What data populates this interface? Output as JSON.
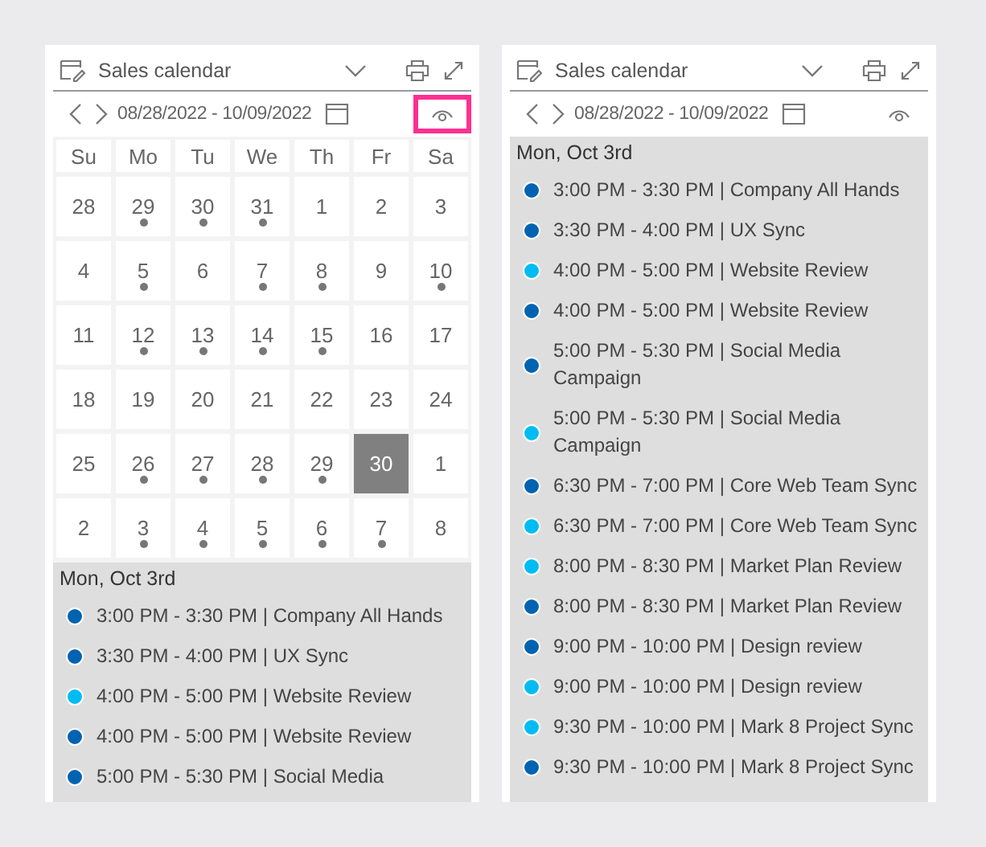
{
  "panels": [
    {
      "title": "Sales calendar",
      "date_range": "08/28/2022 - 10/09/2022",
      "view_toggle_highlighted": true,
      "weekdays": [
        "Su",
        "Mo",
        "Tu",
        "We",
        "Th",
        "Fr",
        "Sa"
      ],
      "weeks": [
        [
          {
            "day": "28",
            "dot": false,
            "selected": false
          },
          {
            "day": "29",
            "dot": true,
            "selected": false
          },
          {
            "day": "30",
            "dot": true,
            "selected": false
          },
          {
            "day": "31",
            "dot": true,
            "selected": false
          },
          {
            "day": "1",
            "dot": false,
            "selected": false
          },
          {
            "day": "2",
            "dot": false,
            "selected": false
          },
          {
            "day": "3",
            "dot": false,
            "selected": false
          }
        ],
        [
          {
            "day": "4",
            "dot": false,
            "selected": false
          },
          {
            "day": "5",
            "dot": true,
            "selected": false
          },
          {
            "day": "6",
            "dot": false,
            "selected": false
          },
          {
            "day": "7",
            "dot": true,
            "selected": false
          },
          {
            "day": "8",
            "dot": true,
            "selected": false
          },
          {
            "day": "9",
            "dot": false,
            "selected": false
          },
          {
            "day": "10",
            "dot": true,
            "selected": false
          }
        ],
        [
          {
            "day": "11",
            "dot": false,
            "selected": false
          },
          {
            "day": "12",
            "dot": true,
            "selected": false
          },
          {
            "day": "13",
            "dot": true,
            "selected": false
          },
          {
            "day": "14",
            "dot": true,
            "selected": false
          },
          {
            "day": "15",
            "dot": true,
            "selected": false
          },
          {
            "day": "16",
            "dot": false,
            "selected": false
          },
          {
            "day": "17",
            "dot": false,
            "selected": false
          }
        ],
        [
          {
            "day": "18",
            "dot": false,
            "selected": false
          },
          {
            "day": "19",
            "dot": false,
            "selected": false
          },
          {
            "day": "20",
            "dot": false,
            "selected": false
          },
          {
            "day": "21",
            "dot": false,
            "selected": false
          },
          {
            "day": "22",
            "dot": false,
            "selected": false
          },
          {
            "day": "23",
            "dot": false,
            "selected": false
          },
          {
            "day": "24",
            "dot": false,
            "selected": false
          }
        ],
        [
          {
            "day": "25",
            "dot": false,
            "selected": false
          },
          {
            "day": "26",
            "dot": true,
            "selected": false
          },
          {
            "day": "27",
            "dot": true,
            "selected": false
          },
          {
            "day": "28",
            "dot": true,
            "selected": false
          },
          {
            "day": "29",
            "dot": true,
            "selected": false
          },
          {
            "day": "30",
            "dot": false,
            "selected": true
          },
          {
            "day": "1",
            "dot": false,
            "selected": false
          }
        ],
        [
          {
            "day": "2",
            "dot": false,
            "selected": false
          },
          {
            "day": "3",
            "dot": true,
            "selected": false
          },
          {
            "day": "4",
            "dot": true,
            "selected": false
          },
          {
            "day": "5",
            "dot": true,
            "selected": false
          },
          {
            "day": "6",
            "dot": true,
            "selected": false
          },
          {
            "day": "7",
            "dot": true,
            "selected": false
          },
          {
            "day": "8",
            "dot": false,
            "selected": false
          }
        ]
      ],
      "agenda_heading": "Mon, Oct 3rd",
      "events": [
        {
          "text": "3:00 PM - 3:30 PM | Company All Hands",
          "color": "#0063b1"
        },
        {
          "text": "3:30 PM - 4:00 PM | UX Sync",
          "color": "#0063b1"
        },
        {
          "text": "4:00 PM - 5:00 PM | Website Review",
          "color": "#00bcf2"
        },
        {
          "text": "4:00 PM - 5:00 PM | Website Review",
          "color": "#0063b1"
        },
        {
          "text": "5:00 PM - 5:30 PM | Social Media",
          "color": "#0063b1"
        }
      ]
    },
    {
      "title": "Sales calendar",
      "date_range": "08/28/2022 - 10/09/2022",
      "view_toggle_highlighted": false,
      "agenda_heading": "Mon, Oct 3rd",
      "events": [
        {
          "text": "3:00 PM - 3:30 PM | Company All Hands",
          "color": "#0063b1"
        },
        {
          "text": "3:30 PM - 4:00 PM | UX Sync",
          "color": "#0063b1"
        },
        {
          "text": "4:00 PM - 5:00 PM | Website Review",
          "color": "#00bcf2"
        },
        {
          "text": "4:00 PM - 5:00 PM | Website Review",
          "color": "#0063b1"
        },
        {
          "text": "5:00 PM - 5:30 PM | Social Media Campaign",
          "color": "#0063b1"
        },
        {
          "text": "5:00 PM - 5:30 PM | Social Media Campaign",
          "color": "#00bcf2"
        },
        {
          "text": "6:30 PM - 7:00 PM | Core Web Team Sync",
          "color": "#0063b1"
        },
        {
          "text": "6:30 PM - 7:00 PM | Core Web Team Sync",
          "color": "#00bcf2"
        },
        {
          "text": "8:00 PM - 8:30 PM | Market Plan Review",
          "color": "#00bcf2"
        },
        {
          "text": "8:00 PM - 8:30 PM | Market Plan Review",
          "color": "#0063b1"
        },
        {
          "text": "9:00 PM - 10:00 PM | Design review",
          "color": "#0063b1"
        },
        {
          "text": "9:00 PM - 10:00 PM | Design review",
          "color": "#00bcf2"
        },
        {
          "text": "9:30 PM - 10:00 PM | Mark 8 Project Sync",
          "color": "#00bcf2"
        },
        {
          "text": "9:30 PM - 10:00 PM | Mark 8 Project Sync",
          "color": "#0063b1"
        }
      ]
    }
  ]
}
